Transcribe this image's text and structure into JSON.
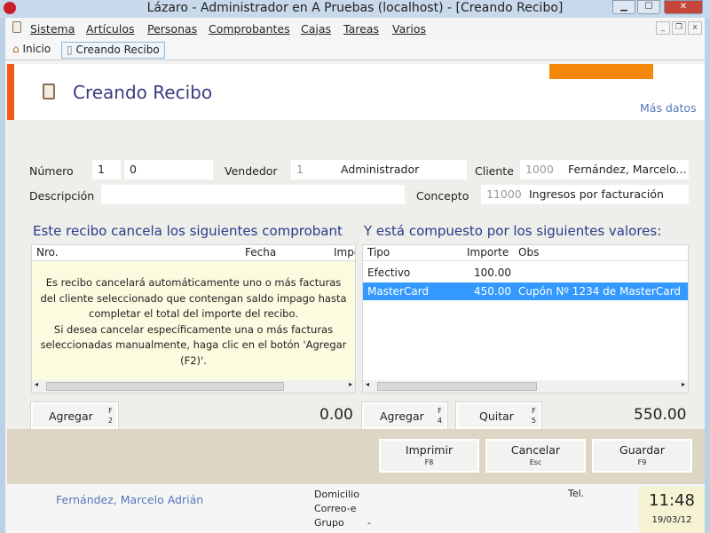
{
  "window": {
    "title": "Lázaro - Administrador en A Pruebas (localhost) - [Creando Recibo]"
  },
  "menu": [
    "Sistema",
    "Artículos",
    "Personas",
    "Comprobantes",
    "Cajas",
    "Tareas",
    "Varios"
  ],
  "tabs": {
    "home": "Inicio",
    "current": "Creando Recibo"
  },
  "header": {
    "title": "Creando Recibo",
    "more": "Más datos"
  },
  "form": {
    "numero_label": "Número",
    "numero_a": "1",
    "numero_b": "0",
    "vendedor_label": "Vendedor",
    "vendedor_id": "1",
    "vendedor_name": "Administrador",
    "cliente_label": "Cliente",
    "cliente_id": "1000",
    "cliente_name": "Fernández, Marcelo...",
    "descripcion_label": "Descripción",
    "descripcion": "",
    "concepto_label": "Concepto",
    "concepto_id": "11000",
    "concepto_name": "Ingresos por facturación"
  },
  "left": {
    "title": "Este recibo cancela los siguientes comprobant",
    "cols": [
      "Nro.",
      "Fecha",
      "Impo"
    ],
    "notice": "Es recibo cancelará automáticamente uno o más facturas del cliente seleccionado que contengan saldo impago hasta completar el total del importe del recibo.\nSi desea cancelar específicamente una o más facturas seleccionadas manualmente, haga clic en el botón 'Agregar (F2)'.",
    "add": "Agregar",
    "add_key": "F 2",
    "total": "0.00"
  },
  "right": {
    "title": "Y está compuesto por los siguientes valores:",
    "cols": [
      "Tipo",
      "Importe",
      "Obs"
    ],
    "rows": [
      {
        "tipo": "Efectivo",
        "importe": "100.00",
        "obs": ""
      },
      {
        "tipo": "MasterCard",
        "importe": "450.00",
        "obs": "Cupón Nº 1234 de MasterCard"
      }
    ],
    "selected_row": 1,
    "add": "Agregar",
    "add_key": "F 4",
    "remove": "Quitar",
    "remove_key": "F 5",
    "total": "550.00"
  },
  "actions": [
    {
      "label": "Imprimir",
      "key": "F8"
    },
    {
      "label": "Cancelar",
      "key": "Esc"
    },
    {
      "label": "Guardar",
      "key": "F9"
    }
  ],
  "footer": {
    "client": "Fernández, Marcelo Adrián",
    "domicilio": "Domicilio",
    "correo": "Correo-e",
    "grupo": "Grupo",
    "grupo_val": "-",
    "tel": "Tel.",
    "time": "11:48",
    "date": "19/03/12"
  },
  "colors": {
    "accent": "#f05a14",
    "orange": "#f5870a",
    "selection": "#3399ff",
    "title": "#3a3a80"
  }
}
